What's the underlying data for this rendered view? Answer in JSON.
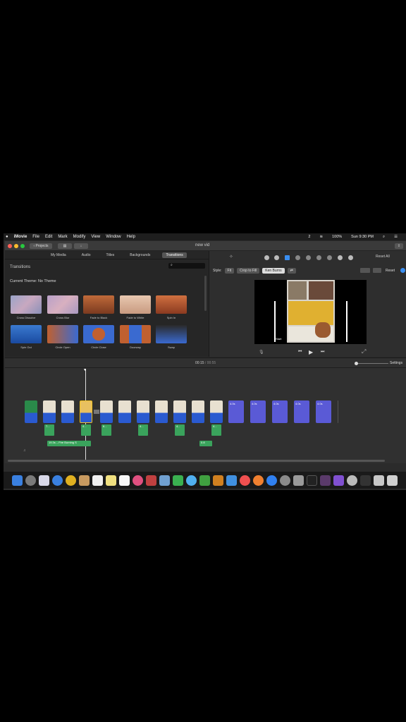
{
  "menubar": {
    "items": [
      "iMovie",
      "File",
      "Edit",
      "Mark",
      "Modify",
      "View",
      "Window",
      "Help"
    ],
    "right": {
      "status": "2",
      "battery": "100%",
      "clock": "Sun 9:30 PM"
    }
  },
  "titlebar": {
    "back_label": "Projects",
    "doc_title": "new vid"
  },
  "browser_tabs": [
    "My Media",
    "Audio",
    "Titles",
    "Backgrounds",
    "Transitions"
  ],
  "transitions": {
    "heading": "Transitions",
    "theme_label": "Current Theme: No Theme",
    "items": [
      "Cross Dissolve",
      "Cross Blur",
      "Fade to Black",
      "Fade to White",
      "Spin In",
      "Spin Out",
      "Circle Open",
      "Circle Close",
      "Doorway",
      "Swap"
    ]
  },
  "viewer": {
    "reset_all": "Reset All",
    "style_label": "Style:",
    "styles": [
      "Fit",
      "Crop to Fill",
      "Ken Burns"
    ],
    "reset": "Reset",
    "start_label": "Start"
  },
  "timeline": {
    "time_current": "00:15",
    "time_separator": "/",
    "time_total": "00:55",
    "settings": "Settings",
    "audio_label": "19.3s – Fire Burning S",
    "clip_labels": [
      "4.0s",
      "4.0s",
      "4.0s",
      "4.0s",
      "4.0s",
      "4.0s"
    ],
    "audio_small": [
      "7...",
      "4...",
      "6...",
      "4...",
      "4...",
      "4...",
      "0.8"
    ]
  },
  "colors": {
    "accent": "#3a8ef0",
    "purple_clip": "#5a5ad6",
    "audio_green": "#3aa35c"
  }
}
